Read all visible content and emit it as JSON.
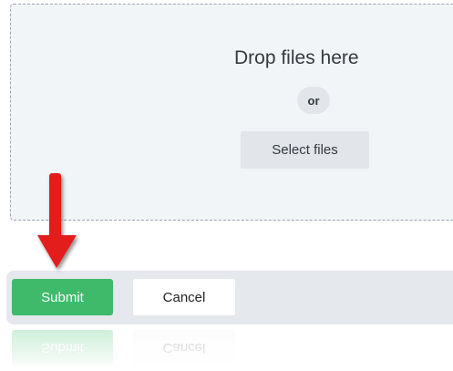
{
  "dropzone": {
    "title": "Drop files here",
    "or_label": "or",
    "select_button_label": "Select files"
  },
  "footer": {
    "submit_label": "Submit",
    "cancel_label": "Cancel"
  },
  "annotation": {
    "arrow_icon": "red-down-arrow-icon",
    "arrow_color": "#e31b1b"
  },
  "colors": {
    "submit_green": "#3fba6a",
    "dropzone_bg": "#f2f5f8",
    "footer_bg": "#e5e8ec"
  }
}
